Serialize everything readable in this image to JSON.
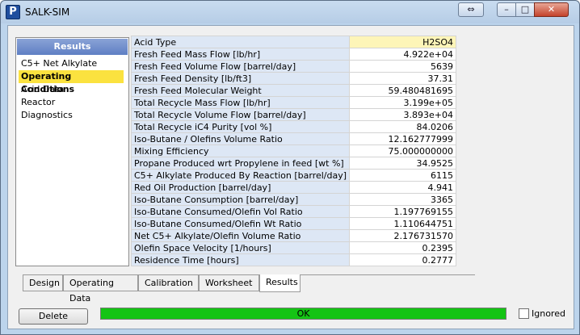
{
  "window": {
    "title": "SALK-SIM",
    "app_icon_letter": "P",
    "buttons": {
      "swap": "⇔",
      "minimize": "–",
      "maximize": "□",
      "close": "✕"
    }
  },
  "sidebar": {
    "header": "Results",
    "items": [
      {
        "label": "C5+ Net Alkylate",
        "active": false
      },
      {
        "label": "Operating Conditions",
        "active": true
      },
      {
        "label": "Acid Data",
        "active": false
      },
      {
        "label": "Reactor",
        "active": false
      },
      {
        "label": "Diagnostics",
        "active": false
      }
    ]
  },
  "table": {
    "rows": [
      {
        "label": "Acid Type",
        "value": "H2SO4"
      },
      {
        "label": "Fresh Feed Mass Flow [lb/hr]",
        "value": "4.922e+04"
      },
      {
        "label": "Fresh Feed Volume Flow [barrel/day]",
        "value": "5639"
      },
      {
        "label": "Fresh Feed Density [lb/ft3]",
        "value": "37.31"
      },
      {
        "label": "Fresh Feed Molecular Weight",
        "value": "59.480481695"
      },
      {
        "label": "Total Recycle Mass Flow [lb/hr]",
        "value": "3.199e+05"
      },
      {
        "label": "Total Recycle Volume Flow [barrel/day]",
        "value": "3.893e+04"
      },
      {
        "label": "Total Recycle iC4 Purity [vol %]",
        "value": "84.0206"
      },
      {
        "label": "Iso-Butane / Olefins Volume Ratio",
        "value": "12.162777999"
      },
      {
        "label": "Mixing Efficiency",
        "value": "75.000000000"
      },
      {
        "label": "Propane Produced wrt Propylene in feed [wt %]",
        "value": "34.9525"
      },
      {
        "label": "C5+ Alkylate Produced By Reaction [barrel/day]",
        "value": "6115"
      },
      {
        "label": "Red Oil Production [barrel/day]",
        "value": "4.941"
      },
      {
        "label": "Iso-Butane Consumption [barrel/day]",
        "value": "3365"
      },
      {
        "label": "Iso-Butane Consumed/Olefin Vol Ratio",
        "value": "1.197769155"
      },
      {
        "label": "Iso-Butane Consumed/Olefin Wt Ratio",
        "value": "1.110644751"
      },
      {
        "label": "Net C5+ Alkylate/Olefin Volume Ratio",
        "value": "2.176731570"
      },
      {
        "label": "Olefin Space Velocity [1/hours]",
        "value": "0.2395"
      },
      {
        "label": "Residence Time [hours]",
        "value": "0.2777"
      }
    ]
  },
  "tabs": [
    {
      "label": "Design",
      "active": false
    },
    {
      "label": "Operating Data",
      "active": false
    },
    {
      "label": "Calibration",
      "active": false
    },
    {
      "label": "Worksheet",
      "active": false
    },
    {
      "label": "Results",
      "active": true
    }
  ],
  "footer": {
    "delete_label": "Delete",
    "status_text": "OK",
    "status_color": "#14c414",
    "ignored_label": "Ignored",
    "ignored_checked": false
  }
}
